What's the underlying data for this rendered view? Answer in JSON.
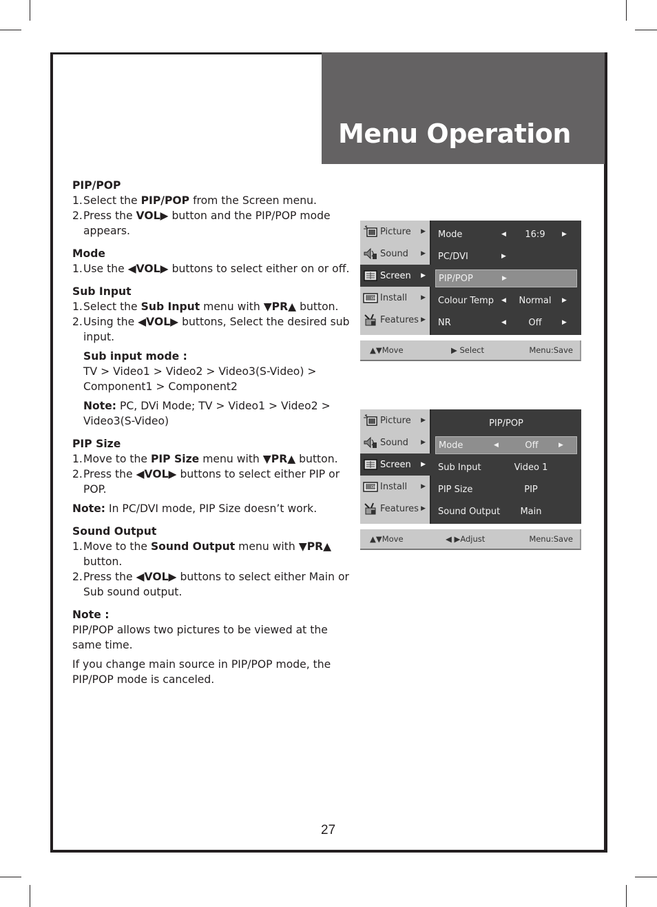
{
  "header": {
    "title": "Menu Operation"
  },
  "page_number": "27",
  "sections": [
    {
      "heading": "PIP/POP",
      "items": [
        {
          "num": "1.",
          "parts": [
            [
              "Select the ",
              false
            ],
            [
              "PIP/POP",
              true
            ],
            [
              " from the Screen menu.",
              false
            ]
          ]
        },
        {
          "num": "2.",
          "parts": [
            [
              "Press the ",
              false
            ],
            [
              "VOL▶",
              true
            ],
            [
              " button and the PIP/POP mode appears.",
              false
            ]
          ]
        }
      ]
    },
    {
      "heading": "Mode",
      "items": [
        {
          "num": "1.",
          "parts": [
            [
              "Use the ",
              false
            ],
            [
              "◀VOL▶",
              true
            ],
            [
              " buttons to select either on or off.",
              false
            ]
          ]
        }
      ]
    },
    {
      "heading": "Sub Input",
      "items": [
        {
          "num": "1.",
          "parts": [
            [
              "Select the ",
              false
            ],
            [
              "Sub Input",
              true
            ],
            [
              " menu with ",
              false
            ],
            [
              "▼PR▲",
              true
            ],
            [
              " button.",
              false
            ]
          ]
        },
        {
          "num": "2.",
          "parts": [
            [
              "Using the ",
              false
            ],
            [
              "◀VOL▶",
              true
            ],
            [
              " buttons, Select the desired sub input.",
              false
            ]
          ]
        }
      ],
      "sub_mode_heading": "Sub input mode :",
      "sub_mode_text": "TV > Video1 > Video2 > Video3(S-Video) > Component1 > Component2",
      "note_label": "Note:",
      "note_text": " PC, DVi Mode; TV > Video1 > Video2 > Video3(S-Video)"
    },
    {
      "heading": "PIP Size",
      "items": [
        {
          "num": "1.",
          "parts": [
            [
              "Move to the ",
              false
            ],
            [
              "PIP Size",
              true
            ],
            [
              " menu with ",
              false
            ],
            [
              "▼PR▲",
              true
            ],
            [
              " button.",
              false
            ]
          ]
        },
        {
          "num": "2.",
          "parts": [
            [
              "Press the ",
              false
            ],
            [
              "◀VOL▶",
              true
            ],
            [
              " buttons to select either PIP or POP.",
              false
            ]
          ]
        }
      ],
      "note_label": "Note:",
      "note_text": " In PC/DVI mode, PIP Size doesn’t work."
    },
    {
      "heading": "Sound Output",
      "items": [
        {
          "num": "1.",
          "parts": [
            [
              "Move to the ",
              false
            ],
            [
              "Sound Output",
              true
            ],
            [
              " menu with ",
              false
            ],
            [
              "▼PR▲",
              true
            ],
            [
              " button.",
              false
            ]
          ]
        },
        {
          "num": "2.",
          "parts": [
            [
              "Press the ",
              false
            ],
            [
              "◀VOL▶",
              true
            ],
            [
              " buttons to select either Main or Sub sound output.",
              false
            ]
          ]
        }
      ]
    }
  ],
  "final_note": {
    "heading": "Note :",
    "paragraphs": [
      "PIP/POP allows two pictures to be viewed at the same time.",
      "If you change main source in PIP/POP mode, the PIP/POP mode is canceled."
    ]
  },
  "osd_sidebar": [
    {
      "label": "Picture",
      "icon": "picture-icon"
    },
    {
      "label": "Sound",
      "icon": "speaker-icon"
    },
    {
      "label": "Screen",
      "icon": "screen-icon",
      "active": true
    },
    {
      "label": "Install",
      "icon": "install-tv-icon"
    },
    {
      "label": "Features",
      "icon": "features-toolbox-icon"
    }
  ],
  "osd1": {
    "rows": [
      {
        "label": "Mode",
        "left_arrow": true,
        "value": "16:9",
        "right_arrow": true
      },
      {
        "label": "PC/DVI",
        "submenu_arrow": true
      },
      {
        "label": "PIP/POP",
        "submenu_arrow": true,
        "highlighted": true
      },
      {
        "label": "Colour Temp",
        "left_arrow": true,
        "value": "Normal",
        "right_arrow": true
      },
      {
        "label": "NR",
        "left_arrow": true,
        "value": "Off",
        "right_arrow": true
      }
    ],
    "footer": {
      "move": "▲▼Move",
      "action": "▶ Select",
      "save": "Menu:Save"
    }
  },
  "osd2": {
    "title": "PIP/POP",
    "rows": [
      {
        "label": "Mode",
        "left_arrow": true,
        "value": "Off",
        "right_arrow": true,
        "highlighted": true
      },
      {
        "label": "Sub Input",
        "value": "Video 1"
      },
      {
        "label": "PIP Size",
        "value": "PIP"
      },
      {
        "label": "Sound Output",
        "value": "Main"
      }
    ],
    "footer": {
      "move": "▲▼Move",
      "action": "◀ ▶Adjust",
      "save": "Menu:Save"
    }
  },
  "colors": {
    "header_bg": "#646263",
    "osd_dark": "#3b3b3b",
    "osd_light": "#c9c9c9",
    "osd_highlight": "#8e8e8e",
    "ink": "#231f20"
  }
}
